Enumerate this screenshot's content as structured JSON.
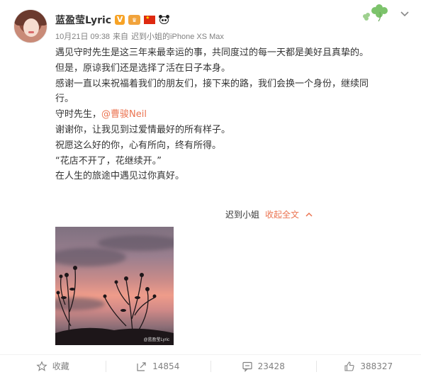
{
  "post": {
    "username": "蓝盈莹Lyric",
    "timestamp": "10月21日 09:38",
    "source_prefix": "来自",
    "source": "迟到小姐的iPhone XS Max",
    "badges": [
      "verified-v-badge",
      "vip-badge",
      "china-flag-badge",
      "panda-badge"
    ],
    "content": {
      "line1": "遇见守时先生是这三年来最幸运的事，共同度过的每一天都是美好且真挚的。",
      "line2": "但是，原谅我们还是选择了活在日子本身。",
      "line3": "感谢一直以来祝福着我们的朋友们，接下来的路，我们会换一个身份，继续同",
      "line4": "行。",
      "line5_prefix": "守时先生，",
      "mention": "@曹骏Neil",
      "line6": "谢谢你，让我见到过爱情最好的所有样子。",
      "line7": "祝愿这么好的你，心有所向，终有所得。",
      "line8": "“花店不开了，花继续开。”",
      "line9": "在人生的旅途中遇见过你真好。"
    },
    "expand": {
      "author": "迟到小姐",
      "collapse_label": "收起全文"
    },
    "image_watermark": "@蓝盈莹Lyric"
  },
  "actions": {
    "favorite_label": "收藏",
    "repost_count": "14854",
    "comment_count": "23428",
    "like_count": "388327"
  },
  "colors": {
    "accent": "#eb7350",
    "text": "#333333",
    "muted": "#808080",
    "verified": "#f7a326"
  }
}
